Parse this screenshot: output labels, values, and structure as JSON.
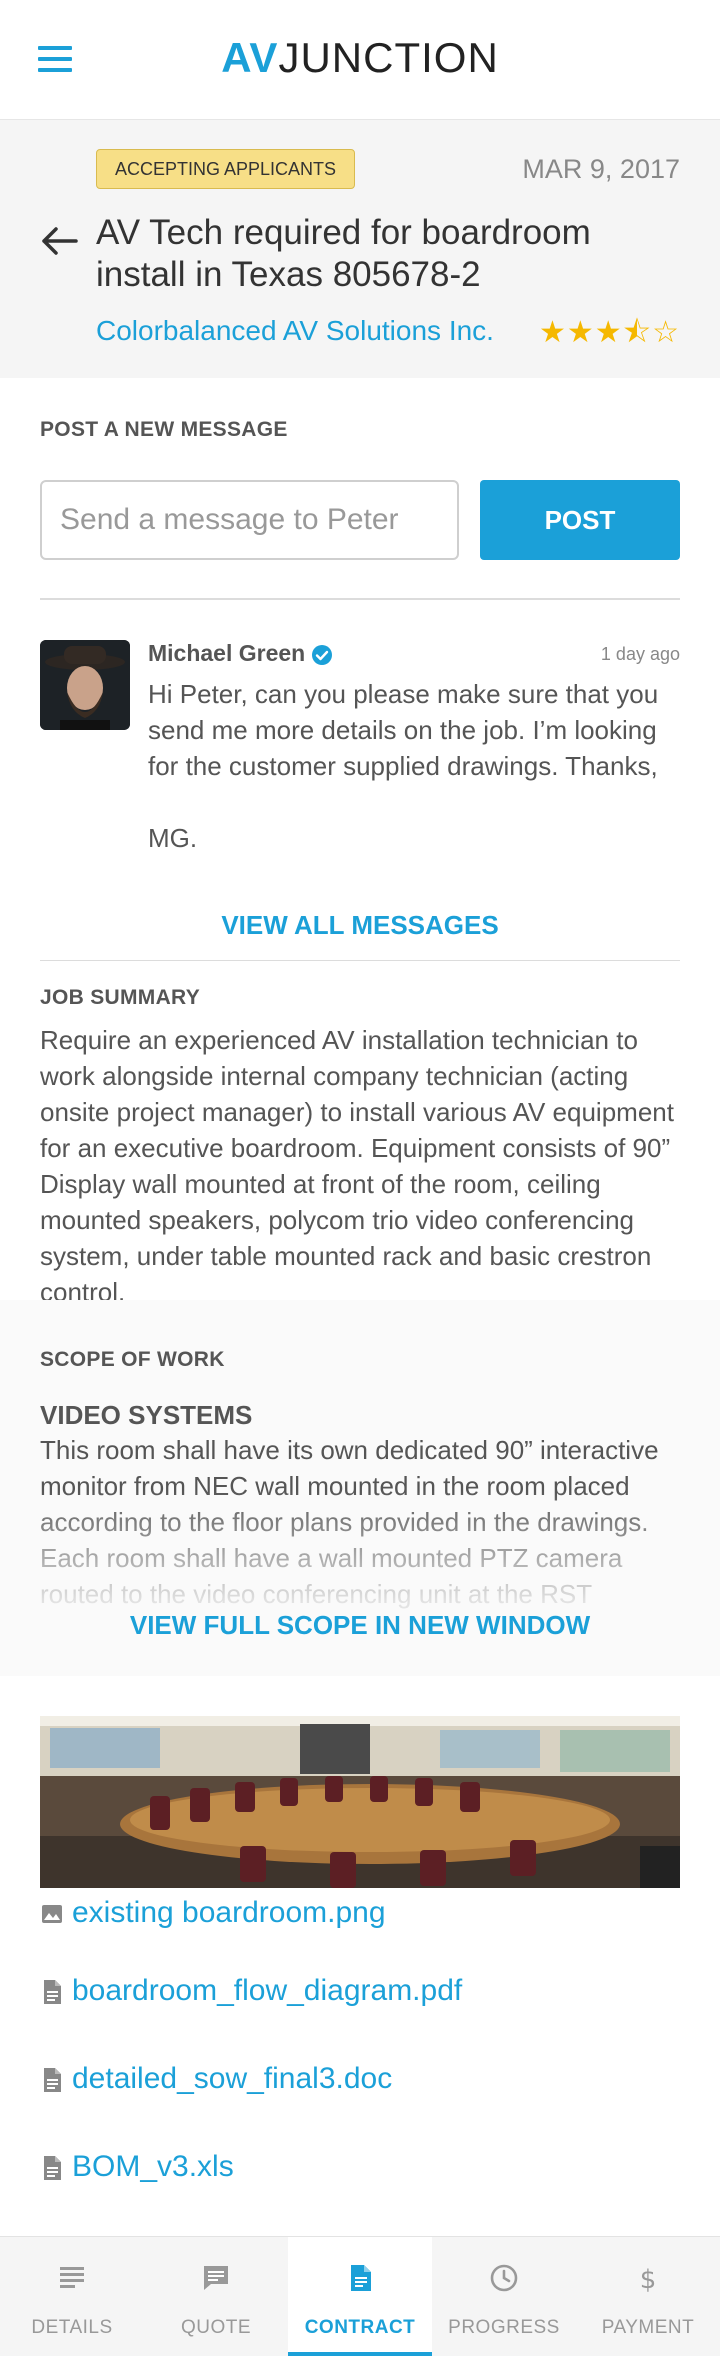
{
  "app": {
    "logo_av": "AV",
    "logo_rest": "JUNCTION"
  },
  "job": {
    "status": "ACCEPTING APPLICANTS",
    "date": "MAR 9, 2017",
    "title": "AV Tech required for boardroom install in Texas 805678-2",
    "company": "Colorbalanced AV Solutions Inc.",
    "rating": 3.5,
    "rating_max": 5
  },
  "messages": {
    "section_label": "POST A NEW MESSAGE",
    "input_placeholder": "Send a message to Peter",
    "post_label": "POST",
    "latest": {
      "author": "Michael Green",
      "time": "1 day ago",
      "body": "Hi Peter, can you please make sure that you send me more details on the job. I’m looking for the customer supplied drawings. Thanks,\n\nMG."
    },
    "view_all_label": "VIEW ALL MESSAGES"
  },
  "summary": {
    "label": "JOB SUMMARY",
    "text": "Require an experienced AV installation technician to work alongside internal company technician (acting onsite project manager) to install various AV equipment for an executive boardroom. Equipment consists of 90” Display wall mounted at front of the room, ceiling mounted speakers, polycom trio video conferencing system, under table mounted rack and basic crestron control."
  },
  "scope": {
    "label": "SCOPE OF WORK",
    "heading": "VIDEO SYSTEMS",
    "text": "This room shall have its own dedicated 90” interactive monitor from NEC wall mounted in the room placed according to the floor plans provided in the drawings. Each room shall have a wall mounted PTZ camera routed to the video conferencing unit at the RST",
    "view_full_label": "VIEW FULL SCOPE IN NEW WINDOW"
  },
  "attachments": [
    {
      "name": "existing boardroom.png",
      "icon": "image-icon"
    },
    {
      "name": "boardroom_flow_diagram.pdf",
      "icon": "document-icon"
    },
    {
      "name": "detailed_sow_final3.doc",
      "icon": "document-icon"
    },
    {
      "name": "BOM_v3.xls",
      "icon": "document-icon"
    }
  ],
  "nav": {
    "tabs": [
      {
        "label": "DETAILS",
        "icon": "details-icon",
        "active": false
      },
      {
        "label": "QUOTE",
        "icon": "chat-icon",
        "active": false
      },
      {
        "label": "CONTRACT",
        "icon": "document-icon",
        "active": true
      },
      {
        "label": "PROGRESS",
        "icon": "clock-icon",
        "active": false
      },
      {
        "label": "PAYMENT",
        "icon": "dollar-icon",
        "active": false
      }
    ]
  },
  "colors": {
    "accent": "#1ba0d8",
    "badge": "#f7df87",
    "star": "#f5b800"
  }
}
